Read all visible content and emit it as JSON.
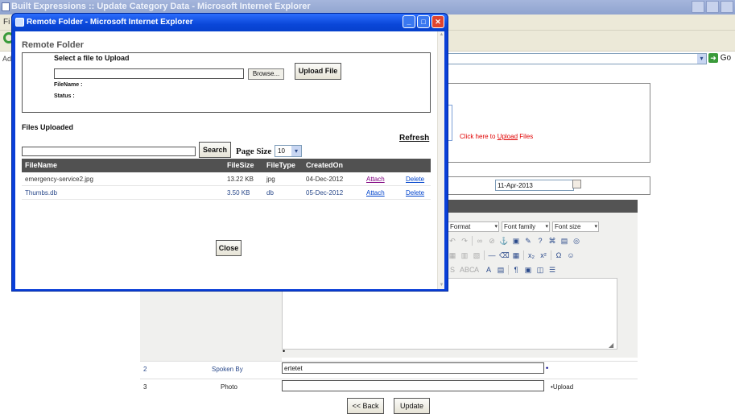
{
  "background_window": {
    "title": "Built Expressions :: Update Category Data - Microsoft Internet Explorer",
    "menu_first": "Fi",
    "address_label": "Ad",
    "go_label": "Go"
  },
  "background_page": {
    "upload_prefix": "Click here to",
    "upload_link": "Upload",
    "upload_suffix": "Files",
    "date_value": "11-Apr-2013",
    "editor": {
      "format_label": "Format",
      "font_family_label": "Font family",
      "font_size_label": "Font size"
    },
    "rows": [
      {
        "number": "2",
        "label": "Spoken By",
        "value": "ertetet"
      },
      {
        "number": "3",
        "label": "Photo",
        "value": "",
        "suffix": "Upload"
      }
    ],
    "back_button": "<< Back",
    "update_button": "Update"
  },
  "popup": {
    "title": "Remote Folder - Microsoft Internet Explorer",
    "heading": "Remote Folder",
    "select_label": "Select a file to Upload",
    "browse_label": "Browse...",
    "upload_button": "Upload File",
    "filename_label": "FileName :",
    "status_label": "Status :",
    "files_uploaded_label": "Files Uploaded",
    "refresh_label": "Refresh",
    "search_button": "Search",
    "page_size_label": "Page Size",
    "page_size_value": "10",
    "close_button": "Close",
    "table": {
      "headers": [
        "FileName",
        "FileSize",
        "FileType",
        "CreatedOn"
      ],
      "rows": [
        {
          "name": "emergency-service2.jpg",
          "size": "13.22 KB",
          "type": "jpg",
          "created": "04-Dec-2012",
          "attach": "Attach",
          "delete": "Delete"
        },
        {
          "name": "Thumbs.db",
          "size": "3.50 KB",
          "type": "db",
          "created": "05-Dec-2012",
          "attach": "Attach",
          "delete": "Delete"
        }
      ]
    }
  },
  "colors": {
    "titlebar_blue": "#0a47d9",
    "table_header": "#515151",
    "upload_red": "#e00000",
    "link_blue": "#0044cc"
  }
}
